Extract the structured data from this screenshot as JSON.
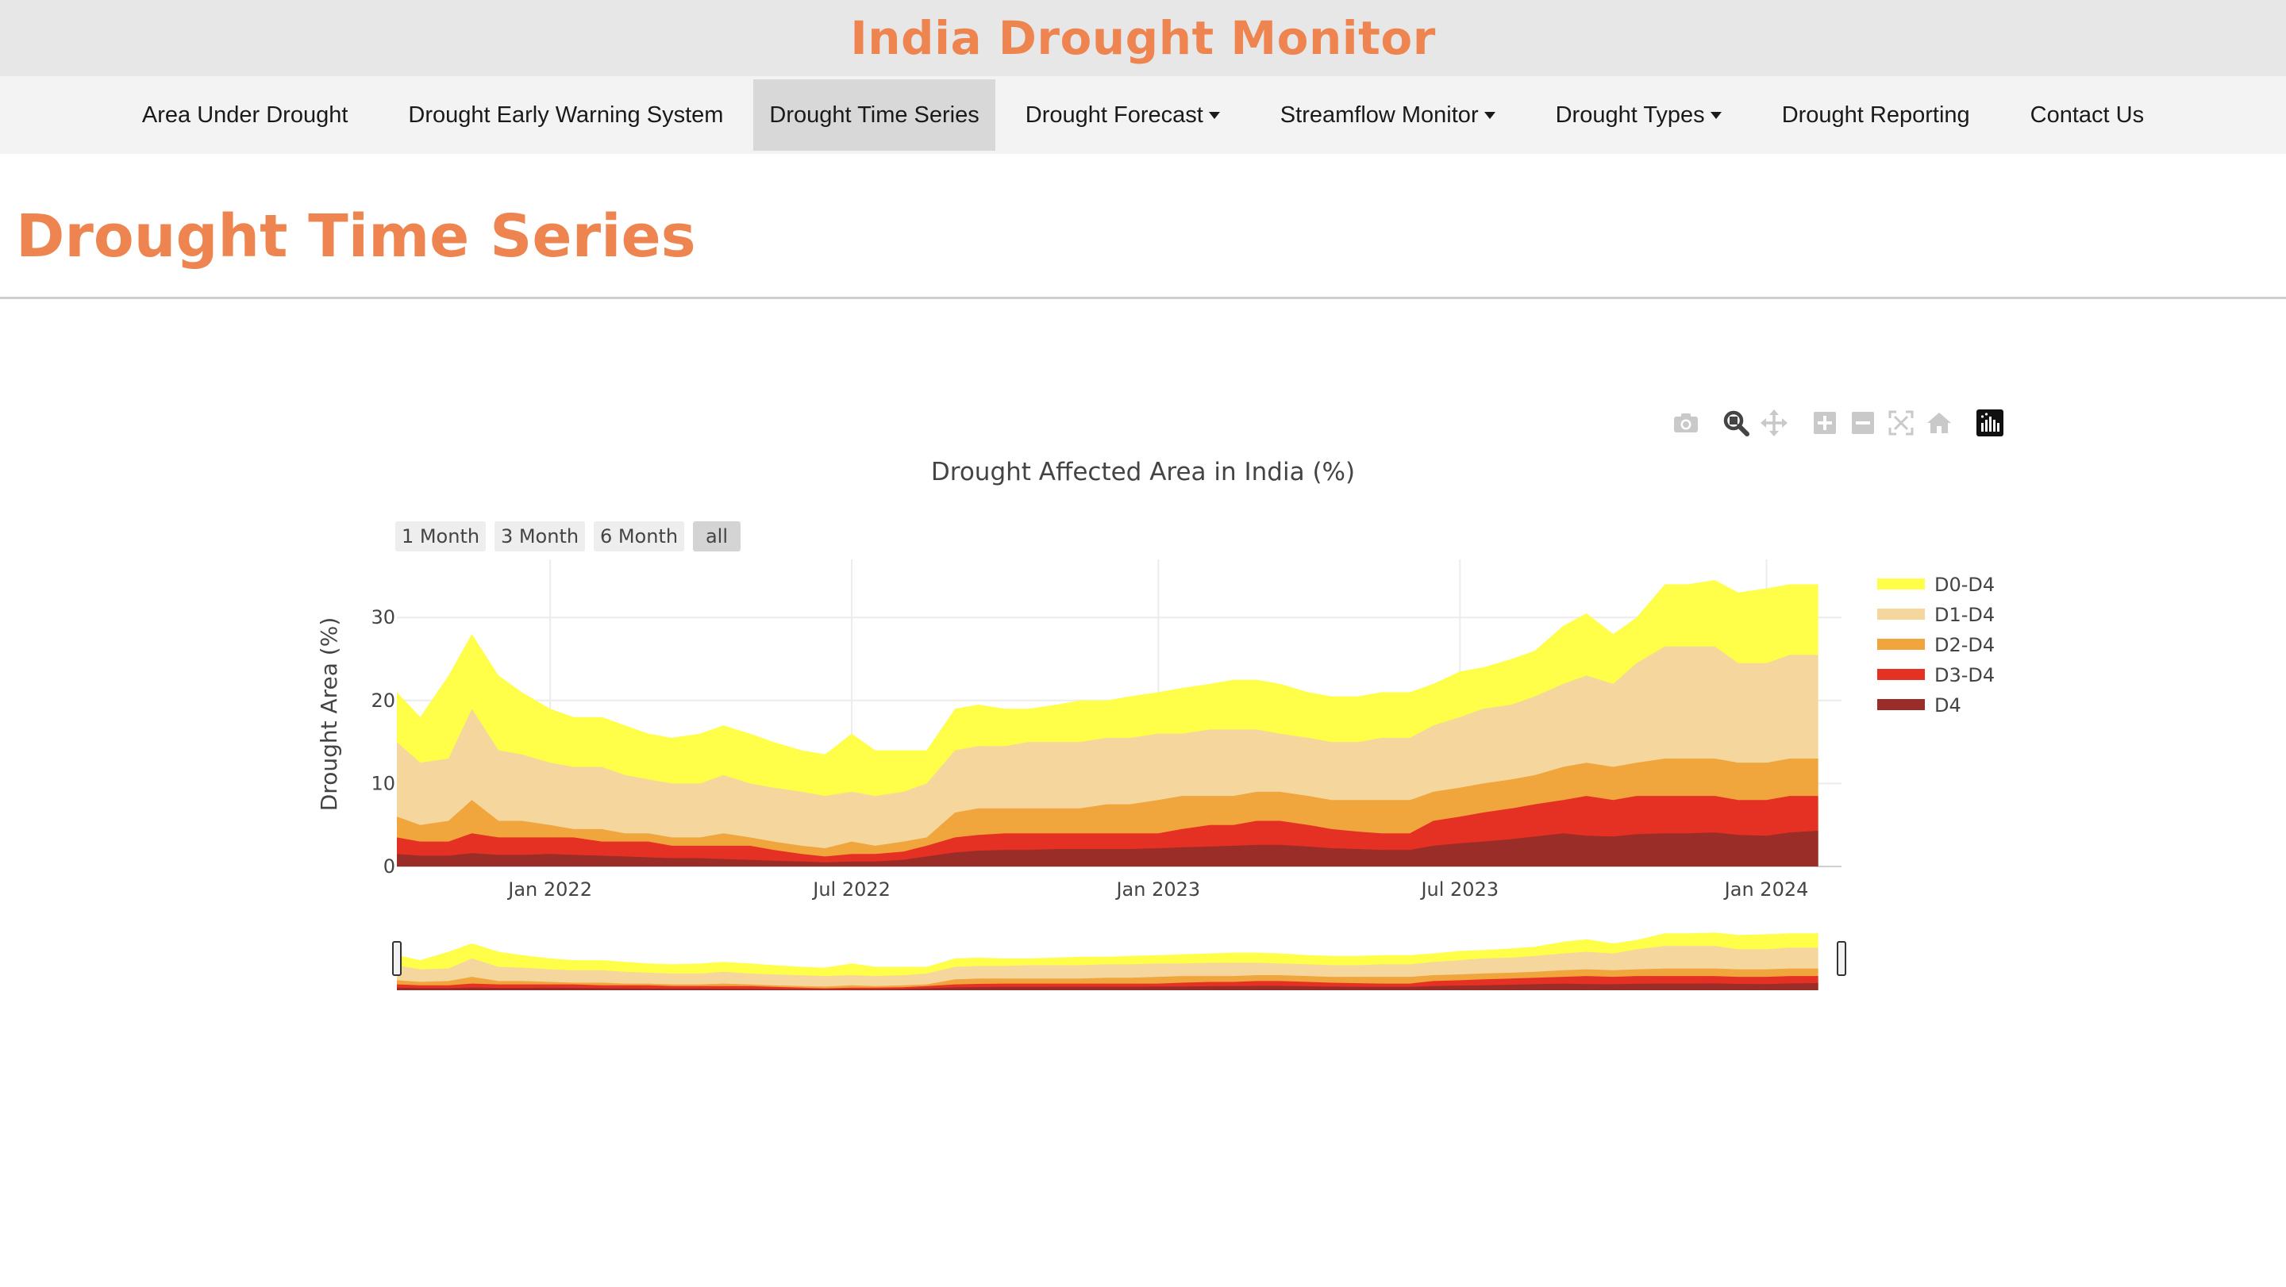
{
  "header": {
    "site_title": "India Drought Monitor"
  },
  "nav": {
    "items": [
      {
        "label": "Area Under Drought",
        "dropdown": false,
        "active": false
      },
      {
        "label": "Drought Early Warning System",
        "dropdown": false,
        "active": false
      },
      {
        "label": "Drought Time Series",
        "dropdown": false,
        "active": true
      },
      {
        "label": "Drought Forecast",
        "dropdown": true,
        "active": false
      },
      {
        "label": "Streamflow Monitor",
        "dropdown": true,
        "active": false
      },
      {
        "label": "Drought Types",
        "dropdown": true,
        "active": false
      },
      {
        "label": "Drought Reporting",
        "dropdown": false,
        "active": false
      },
      {
        "label": "Contact Us",
        "dropdown": false,
        "active": false
      }
    ]
  },
  "page": {
    "title": "Drought Time Series"
  },
  "modebar": {
    "icons": [
      "camera-icon",
      "zoom-icon",
      "pan-icon",
      "zoom-in-icon",
      "zoom-out-icon",
      "autoscale-icon",
      "reset-axes-icon",
      "plotly-logo-icon"
    ]
  },
  "range_selector": {
    "buttons": [
      "1 Month",
      "3 Month",
      "6 Month",
      "all"
    ],
    "selected": "all"
  },
  "colors": {
    "accent": "#ee8550",
    "D0-D4": "#ffff4a",
    "D1-D4": "#f5d79e",
    "D2-D4": "#f0a63c",
    "D3-D4": "#e53124",
    "D4": "#9b2d28"
  },
  "chart_data": {
    "type": "area",
    "title": "Drought Affected Area in India (%)",
    "xlabel": "",
    "ylabel": "Drought Area (%)",
    "ylim": [
      0,
      37
    ],
    "xlim": [
      "2021-10-01",
      "2024-02-15"
    ],
    "yticks": [
      0,
      10,
      20,
      30
    ],
    "xticks": [
      {
        "date": "2022-01-01",
        "label": "Jan 2022"
      },
      {
        "date": "2022-07-01",
        "label": "Jul 2022"
      },
      {
        "date": "2023-01-01",
        "label": "Jan 2023"
      },
      {
        "date": "2023-07-01",
        "label": "Jul 2023"
      },
      {
        "date": "2024-01-01",
        "label": "Jan 2024"
      }
    ],
    "grid": true,
    "legend_position": "right",
    "x": [
      "2021-10-01",
      "2021-10-15",
      "2021-11-01",
      "2021-11-15",
      "2021-12-01",
      "2021-12-15",
      "2022-01-01",
      "2022-01-15",
      "2022-02-01",
      "2022-02-15",
      "2022-03-01",
      "2022-03-15",
      "2022-04-01",
      "2022-04-15",
      "2022-05-01",
      "2022-05-15",
      "2022-06-01",
      "2022-06-15",
      "2022-07-01",
      "2022-07-15",
      "2022-08-01",
      "2022-08-15",
      "2022-09-01",
      "2022-09-15",
      "2022-10-01",
      "2022-10-15",
      "2022-11-01",
      "2022-11-15",
      "2022-12-01",
      "2022-12-15",
      "2023-01-01",
      "2023-01-15",
      "2023-02-01",
      "2023-02-15",
      "2023-03-01",
      "2023-03-15",
      "2023-04-01",
      "2023-04-15",
      "2023-05-01",
      "2023-05-15",
      "2023-06-01",
      "2023-06-15",
      "2023-07-01",
      "2023-07-15",
      "2023-08-01",
      "2023-08-15",
      "2023-09-01",
      "2023-09-15",
      "2023-10-01",
      "2023-10-15",
      "2023-11-01",
      "2023-11-15",
      "2023-12-01",
      "2023-12-15",
      "2024-01-01",
      "2024-01-15",
      "2024-02-01"
    ],
    "series": [
      {
        "name": "D0-D4",
        "color": "#ffff4a",
        "values": [
          21,
          18,
          23,
          28,
          23,
          21,
          19,
          18,
          18,
          17,
          16,
          15.5,
          16,
          17,
          16,
          15,
          14,
          13.5,
          16,
          14,
          14,
          14,
          19,
          19.5,
          19,
          19,
          19.5,
          20,
          20,
          20.5,
          21,
          21.5,
          22,
          22.5,
          22.5,
          22,
          21,
          20.5,
          20.5,
          21,
          21,
          22,
          23.5,
          24,
          25,
          26,
          29,
          30.5,
          28,
          30,
          34,
          34,
          34.5,
          33,
          33.5,
          34,
          34
        ]
      },
      {
        "name": "D1-D4",
        "color": "#f5d79e",
        "values": [
          15,
          12.5,
          13,
          19,
          14,
          13.5,
          12.5,
          12,
          12,
          11,
          10.5,
          10,
          10,
          11,
          10,
          9.5,
          9,
          8.5,
          9,
          8.5,
          9,
          10,
          14,
          14.5,
          14.5,
          15,
          15,
          15,
          15.5,
          15.5,
          16,
          16,
          16.5,
          16.5,
          16.5,
          16,
          15.5,
          15,
          15,
          15.5,
          15.5,
          17,
          18,
          19,
          19.5,
          20.5,
          22,
          23,
          22,
          24.5,
          26.5,
          26.5,
          26.5,
          24.5,
          24.5,
          25.5,
          25.5
        ]
      },
      {
        "name": "D2-D4",
        "color": "#f0a63c",
        "values": [
          6,
          5,
          5.5,
          8,
          5.5,
          5.5,
          5,
          4.5,
          4.5,
          4,
          4,
          3.5,
          3.5,
          4,
          3.5,
          3,
          2.5,
          2.2,
          3,
          2.5,
          3,
          3.5,
          6.5,
          7,
          7,
          7,
          7,
          7,
          7.5,
          7.5,
          8,
          8.5,
          8.5,
          8.5,
          9,
          9,
          8.5,
          8,
          8,
          8,
          8,
          9,
          9.5,
          10,
          10.5,
          11,
          12,
          12.5,
          12,
          12.5,
          13,
          13,
          13,
          12.5,
          12.5,
          13,
          13
        ]
      },
      {
        "name": "D3-D4",
        "color": "#e53124",
        "values": [
          3.5,
          3,
          3,
          4,
          3.5,
          3.5,
          3.5,
          3.5,
          3,
          3,
          3,
          2.5,
          2.5,
          2.5,
          2.5,
          2,
          1.5,
          1.2,
          1.5,
          1.5,
          1.8,
          2.5,
          3.5,
          3.8,
          4,
          4,
          4,
          4,
          4,
          4,
          4,
          4.5,
          5,
          5,
          5.5,
          5.5,
          5,
          4.5,
          4.2,
          4,
          4,
          5.5,
          6,
          6.5,
          7,
          7.5,
          8,
          8.5,
          8,
          8.5,
          8.5,
          8.5,
          8.5,
          8,
          8,
          8.5,
          8.5
        ]
      },
      {
        "name": "D4",
        "color": "#9b2d28",
        "values": [
          1.5,
          1.3,
          1.3,
          1.6,
          1.4,
          1.4,
          1.5,
          1.4,
          1.3,
          1.2,
          1.1,
          1,
          1,
          0.9,
          0.8,
          0.7,
          0.6,
          0.5,
          0.6,
          0.6,
          0.8,
          1.2,
          1.7,
          1.9,
          2,
          2,
          2.1,
          2.1,
          2.1,
          2.1,
          2.2,
          2.3,
          2.4,
          2.5,
          2.6,
          2.6,
          2.4,
          2.2,
          2.1,
          2,
          2,
          2.5,
          2.8,
          3,
          3.3,
          3.6,
          4,
          3.7,
          3.6,
          3.9,
          4,
          4,
          4.1,
          3.8,
          3.7,
          4.1,
          4.3
        ]
      }
    ]
  }
}
